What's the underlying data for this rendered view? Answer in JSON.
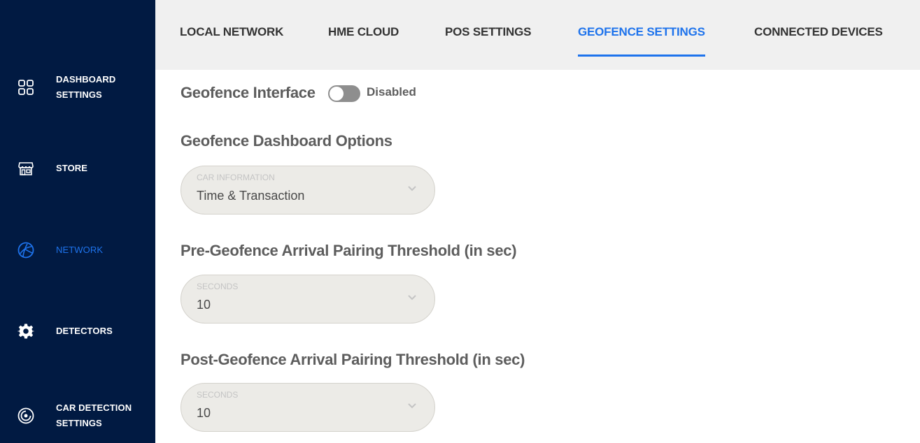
{
  "sidebar": {
    "items": [
      {
        "label": "DASHBOARD\nSETTINGS",
        "icon": "dashboard-grid-icon"
      },
      {
        "label": "STORE",
        "icon": "store-icon"
      },
      {
        "label": "NETWORK",
        "icon": "network-globe-icon",
        "active": true
      },
      {
        "label": "DETECTORS",
        "icon": "gear-icon"
      },
      {
        "label": "CAR DETECTION\nSETTINGS",
        "icon": "radar-target-icon"
      }
    ]
  },
  "tabs": [
    {
      "label": "LOCAL NETWORK"
    },
    {
      "label": "HME CLOUD"
    },
    {
      "label": "POS SETTINGS"
    },
    {
      "label": "GEOFENCE SETTINGS",
      "active": true
    },
    {
      "label": "CONNECTED DEVICES"
    }
  ],
  "geofence": {
    "interface_label": "Geofence Interface",
    "interface_enabled": false,
    "interface_status": "Disabled",
    "dashboard_options_title": "Geofence Dashboard Options",
    "car_info": {
      "caption": "CAR INFORMATION",
      "value": "Time & Transaction"
    },
    "pre_title": "Pre-Geofence Arrival Pairing Threshold (in sec)",
    "pre": {
      "caption": "SECONDS",
      "value": "10"
    },
    "post_title": "Post-Geofence Arrival Pairing Threshold (in sec)",
    "post": {
      "caption": "SECONDS",
      "value": "10"
    }
  },
  "colors": {
    "sidebar_bg": "#011a42",
    "accent": "#1e73ec",
    "topbar_bg": "#f0f0f0",
    "heading_text": "#5d5d5d"
  }
}
